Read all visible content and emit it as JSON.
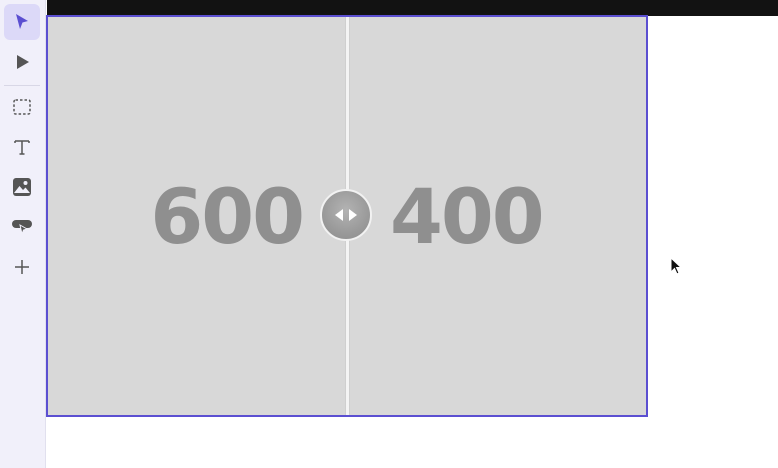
{
  "toolbar": {
    "tools": [
      {
        "name": "select",
        "icon": "pointer-arrow-icon",
        "active": true
      },
      {
        "name": "preview",
        "icon": "play-icon",
        "active": false
      },
      {
        "name": "box",
        "icon": "dashed-rectangle-icon",
        "active": false
      },
      {
        "name": "text",
        "icon": "text-icon",
        "active": false
      },
      {
        "name": "image",
        "icon": "image-icon",
        "active": false
      },
      {
        "name": "button",
        "icon": "button-cursor-icon",
        "active": false
      },
      {
        "name": "add",
        "icon": "plus-icon",
        "active": false
      }
    ]
  },
  "compare": {
    "left_label": "600",
    "right_label": "400",
    "handle_icon": "left-right-arrows-icon",
    "colors": {
      "selection_border": "#5b4fd1",
      "panel_background": "#d8d8d8",
      "number_color": "#8f8f8f"
    }
  },
  "colors": {
    "accent": "#5b4fd1",
    "toolbar_background": "#f1f0fa",
    "active_tool_background": "#dcd9f8",
    "top_strip": "#121212"
  }
}
